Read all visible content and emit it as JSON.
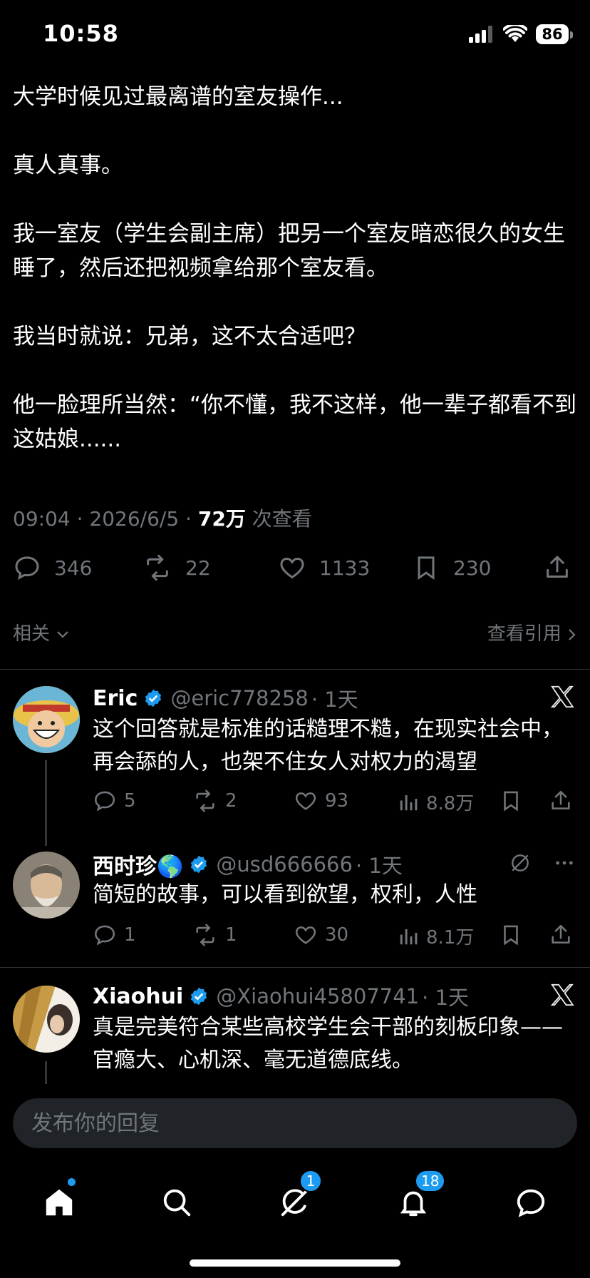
{
  "status_bar": {
    "time": "10:58",
    "battery": "86"
  },
  "tweet": {
    "paragraphs": [
      "大学时候见过最离谱的室友操作...",
      "真人真事。",
      "我一室友（学生会副主席）把另一个室友暗恋很久的女生睡了，然后还把视频拿给那个室友看。",
      "我当时就说：兄弟，这不太合适吧？",
      "他一脸理所当然：“你不懂，我不这样，他一辈子都看不到这姑娘......"
    ],
    "meta_time": "09:04 · 2026/6/5 · ",
    "views_count": "72万",
    "views_label": " 次查看",
    "replies": "346",
    "reposts": "22",
    "likes": "1133",
    "bookmarks": "230"
  },
  "related_label": "相关",
  "view_quotes_label": "查看引用",
  "replies": [
    {
      "name": "Eric",
      "handle": "@eric778258",
      "time": "· 1天",
      "text": "这个回答就是标准的话糙理不糙，在现实社会中，再会舔的人，也架不住女人对权力的渴望",
      "replies": "5",
      "reposts": "2",
      "likes": "93",
      "views": "8.8万"
    },
    {
      "name": "西时珍🌎",
      "handle": "@usd666666",
      "time": "· 1天",
      "text": "简短的故事，可以看到欲望，权利，人性",
      "replies": "1",
      "reposts": "1",
      "likes": "30",
      "views": "8.1万"
    },
    {
      "name": "Xiaohui",
      "handle": "@Xiaohui45807741",
      "time": "· 1天",
      "text": "真是完美符合某些高校学生会干部的刻板印象——官瘾大、心机深、毫无道德底线。"
    }
  ],
  "reply_placeholder": "发布你的回复",
  "tab_bar": {
    "messages_badge": "1",
    "notifications_badge": "18"
  },
  "colors": {
    "accent": "#1d9bf0",
    "muted": "#71767b",
    "background": "#000000"
  }
}
